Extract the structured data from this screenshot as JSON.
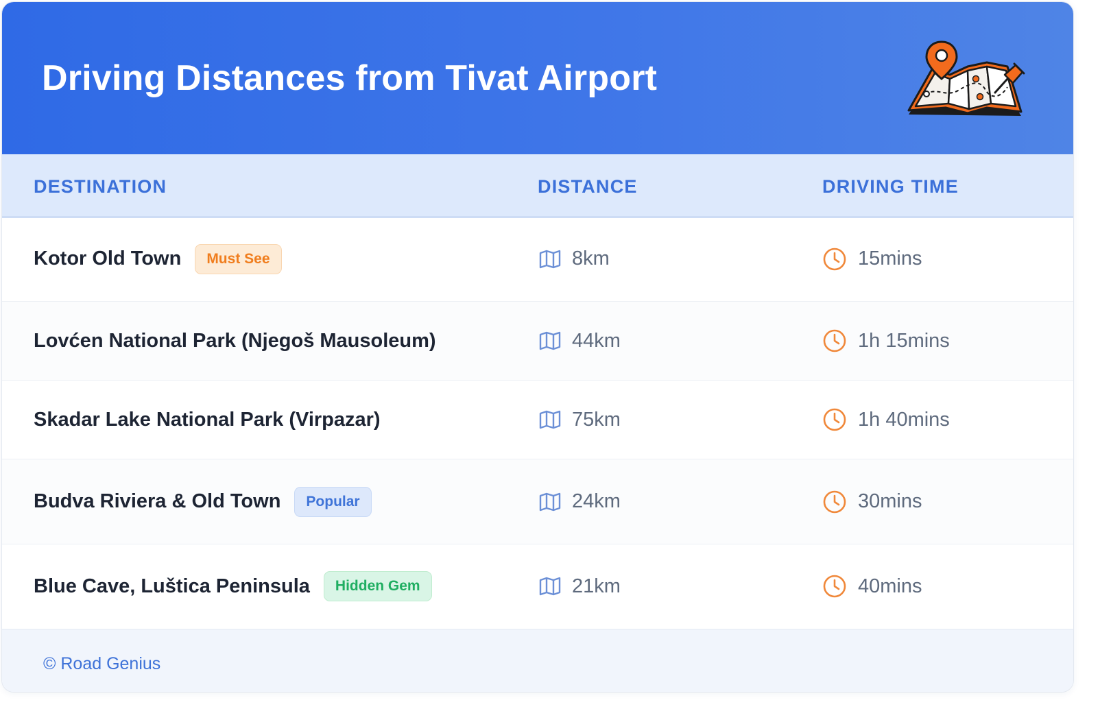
{
  "header": {
    "title": "Driving Distances from Tivat Airport",
    "illustration_icon": "folded-map-with-location-pin-icon",
    "background_color": "#3470e7"
  },
  "table": {
    "columns": [
      "DESTINATION",
      "DISTANCE",
      "DRIVING TIME"
    ],
    "distance_icon": "map-icon",
    "time_icon": "clock-icon",
    "rows": [
      {
        "destination": "Kotor Old Town",
        "badge": "Must See",
        "badge_color": "orange",
        "distance": "8km",
        "time": "15mins"
      },
      {
        "destination": "Lovćen National Park (Njegoš Mausoleum)",
        "badge": "",
        "badge_color": "",
        "distance": "44km",
        "time": "1h 15mins"
      },
      {
        "destination": "Skadar Lake National Park (Virpazar)",
        "badge": "",
        "badge_color": "",
        "distance": "75km",
        "time": "1h 40mins"
      },
      {
        "destination": "Budva Riviera & Old Town",
        "badge": "Popular",
        "badge_color": "blue",
        "distance": "24km",
        "time": "30mins"
      },
      {
        "destination": "Blue Cave, Luštica Peninsula",
        "badge": "Hidden Gem",
        "badge_color": "green",
        "distance": "21km",
        "time": "40mins"
      }
    ]
  },
  "footer": {
    "text": "© Road Genius"
  },
  "colors": {
    "accent": "#3b70d9",
    "header_row_bg": "#dde9fc",
    "clock_icon": "#f0883a",
    "map_icon": "#6b8fd6"
  }
}
